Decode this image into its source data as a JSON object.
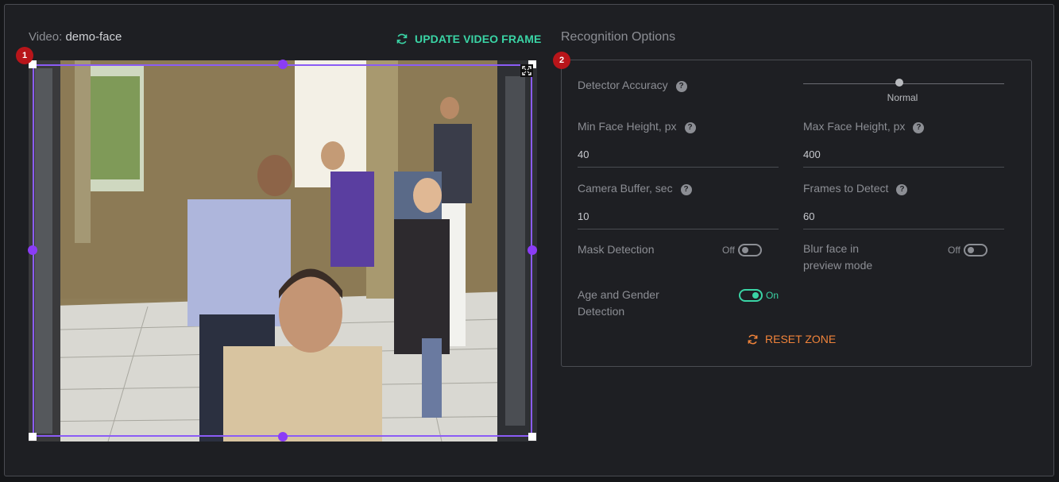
{
  "video": {
    "label": "Video:",
    "name": "demo-face"
  },
  "update_button": {
    "label": "UPDATE VIDEO FRAME"
  },
  "zone_badge": "1",
  "options": {
    "title": "Recognition Options",
    "badge": "2",
    "detector_accuracy": {
      "label": "Detector Accuracy",
      "value": "Normal"
    },
    "min_face_height": {
      "label": "Min Face Height, px",
      "value": "40"
    },
    "max_face_height": {
      "label": "Max Face Height, px",
      "value": "400"
    },
    "camera_buffer": {
      "label": "Camera Buffer, sec",
      "value": "10"
    },
    "frames_to_detect": {
      "label": "Frames to Detect",
      "value": "60"
    },
    "mask_detection": {
      "label": "Mask Detection",
      "state": "Off"
    },
    "blur_face": {
      "label": "Blur face in preview mode",
      "state": "Off"
    },
    "age_gender": {
      "label": "Age and Gender Detection",
      "state": "On"
    },
    "reset_button": {
      "label": "RESET ZONE"
    }
  },
  "colors": {
    "accent": "#3ad4a5",
    "zone": "#8b5cf6",
    "reset": "#f0833a",
    "badge": "#b8151a"
  }
}
